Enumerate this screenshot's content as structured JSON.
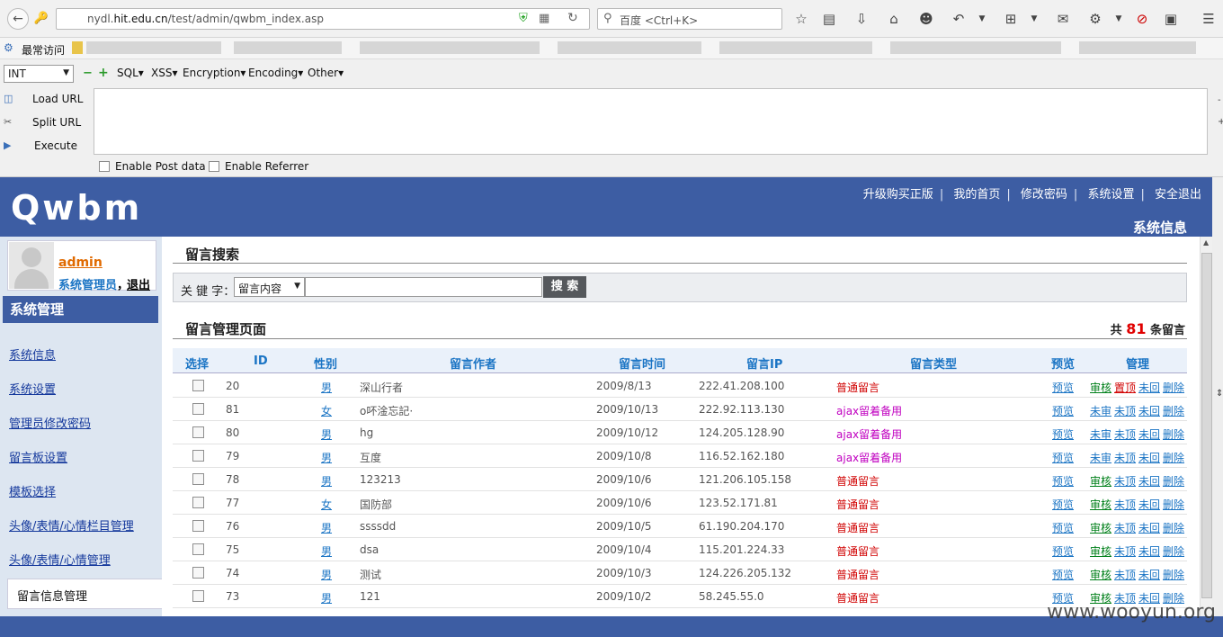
{
  "browser": {
    "url_prefix": "nydl.",
    "url_domain": "hit.edu.cn",
    "url_path": "/test/admin/qwbm_index.asp",
    "search_placeholder": "百度 <Ctrl+K>",
    "bookmarks_label": "最常访问"
  },
  "hackbar": {
    "select_value": "INT",
    "menus": [
      "SQL▾",
      "XSS▾",
      "Encryption▾",
      "Encoding▾",
      "Other▾"
    ],
    "load_url": "Load URL",
    "split_url": "Split URL",
    "execute": "Execute",
    "enable_post": "Enable Post data",
    "enable_referrer": "Enable Referrer"
  },
  "app": {
    "logo": "Qwbm",
    "top_links": [
      "升级购买正版",
      "我的首页",
      "修改密码",
      "系统设置",
      "安全退出"
    ],
    "sys_info": "系统信息",
    "user": {
      "name": "admin",
      "role": "系统管理员",
      "comma": "，",
      "logout": "退出"
    },
    "sidebar_title": "系统管理",
    "sidebar_items": [
      "系统信息",
      "系统设置",
      "管理员修改密码",
      "留言板设置",
      "模板选择",
      "头像/表情/心情栏目管理",
      "头像/表情/心情管理"
    ],
    "sidebar_current": "留言信息管理"
  },
  "search": {
    "title": "留言搜索",
    "keyword_label": "关 键 字：",
    "select_value": "留言内容",
    "button": "搜 索"
  },
  "list": {
    "title": "留言管理页面",
    "total_prefix": "共",
    "total_count": "81",
    "total_suffix": "条留言",
    "headers": [
      "选择",
      "ID",
      "性别",
      "留言作者",
      "留言时间",
      "留言IP",
      "留言类型",
      "预览",
      "管理"
    ],
    "rows": [
      {
        "id": "20",
        "gender": "男",
        "author": "深山行者",
        "time": "2009/8/13",
        "ip": "222.41.208.100",
        "type": "普通留言",
        "type_color": "red",
        "preview": "预览",
        "actions": [
          {
            "t": "审核",
            "c": "grn"
          },
          {
            "t": "置顶",
            "c": "rd"
          },
          {
            "t": "未回",
            "c": "blu"
          },
          {
            "t": "删除",
            "c": "blu"
          }
        ]
      },
      {
        "id": "81",
        "gender": "女",
        "author": "o吥淦忘記·",
        "time": "2009/10/13",
        "ip": "222.92.113.130",
        "type": "ajax留着备用",
        "type_color": "mag",
        "preview": "预览",
        "actions": [
          {
            "t": "未审",
            "c": "blu"
          },
          {
            "t": "未顶",
            "c": "blu"
          },
          {
            "t": "未回",
            "c": "blu"
          },
          {
            "t": "删除",
            "c": "blu"
          }
        ]
      },
      {
        "id": "80",
        "gender": "男",
        "author": "hg",
        "time": "2009/10/12",
        "ip": "124.205.128.90",
        "type": "ajax留着备用",
        "type_color": "mag",
        "preview": "预览",
        "actions": [
          {
            "t": "未审",
            "c": "blu"
          },
          {
            "t": "未顶",
            "c": "blu"
          },
          {
            "t": "未回",
            "c": "blu"
          },
          {
            "t": "删除",
            "c": "blu"
          }
        ]
      },
      {
        "id": "79",
        "gender": "男",
        "author": "互度",
        "time": "2009/10/8",
        "ip": "116.52.162.180",
        "type": "ajax留着备用",
        "type_color": "mag",
        "preview": "预览",
        "actions": [
          {
            "t": "未审",
            "c": "blu"
          },
          {
            "t": "未顶",
            "c": "blu"
          },
          {
            "t": "未回",
            "c": "blu"
          },
          {
            "t": "删除",
            "c": "blu"
          }
        ]
      },
      {
        "id": "78",
        "gender": "男",
        "author": "123213",
        "time": "2009/10/6",
        "ip": "121.206.105.158",
        "type": "普通留言",
        "type_color": "red",
        "preview": "预览",
        "actions": [
          {
            "t": "审核",
            "c": "grn"
          },
          {
            "t": "未顶",
            "c": "blu"
          },
          {
            "t": "未回",
            "c": "blu"
          },
          {
            "t": "删除",
            "c": "blu"
          }
        ]
      },
      {
        "id": "77",
        "gender": "女",
        "author": "国防部",
        "time": "2009/10/6",
        "ip": "123.52.171.81",
        "type": "普通留言",
        "type_color": "red",
        "preview": "预览",
        "actions": [
          {
            "t": "审核",
            "c": "grn"
          },
          {
            "t": "未顶",
            "c": "blu"
          },
          {
            "t": "未回",
            "c": "blu"
          },
          {
            "t": "删除",
            "c": "blu"
          }
        ]
      },
      {
        "id": "76",
        "gender": "男",
        "author": "ssssdd",
        "time": "2009/10/5",
        "ip": "61.190.204.170",
        "type": "普通留言",
        "type_color": "red",
        "preview": "预览",
        "actions": [
          {
            "t": "审核",
            "c": "grn"
          },
          {
            "t": "未顶",
            "c": "blu"
          },
          {
            "t": "未回",
            "c": "blu"
          },
          {
            "t": "删除",
            "c": "blu"
          }
        ]
      },
      {
        "id": "75",
        "gender": "男",
        "author": "dsa",
        "time": "2009/10/4",
        "ip": "115.201.224.33",
        "type": "普通留言",
        "type_color": "red",
        "preview": "预览",
        "actions": [
          {
            "t": "审核",
            "c": "grn"
          },
          {
            "t": "未顶",
            "c": "blu"
          },
          {
            "t": "未回",
            "c": "blu"
          },
          {
            "t": "删除",
            "c": "blu"
          }
        ]
      },
      {
        "id": "74",
        "gender": "男",
        "author": "测试",
        "time": "2009/10/3",
        "ip": "124.226.205.132",
        "type": "普通留言",
        "type_color": "red",
        "preview": "预览",
        "actions": [
          {
            "t": "审核",
            "c": "grn"
          },
          {
            "t": "未顶",
            "c": "blu"
          },
          {
            "t": "未回",
            "c": "blu"
          },
          {
            "t": "删除",
            "c": "blu"
          }
        ]
      },
      {
        "id": "73",
        "gender": "男",
        "author": "121",
        "time": "2009/10/2",
        "ip": "58.245.55.0",
        "type": "普通留言",
        "type_color": "red",
        "preview": "预览",
        "actions": [
          {
            "t": "审核",
            "c": "grn"
          },
          {
            "t": "未顶",
            "c": "blu"
          },
          {
            "t": "未回",
            "c": "blu"
          },
          {
            "t": "删除",
            "c": "blu"
          }
        ]
      }
    ]
  },
  "watermark": "www.wooyun.org"
}
